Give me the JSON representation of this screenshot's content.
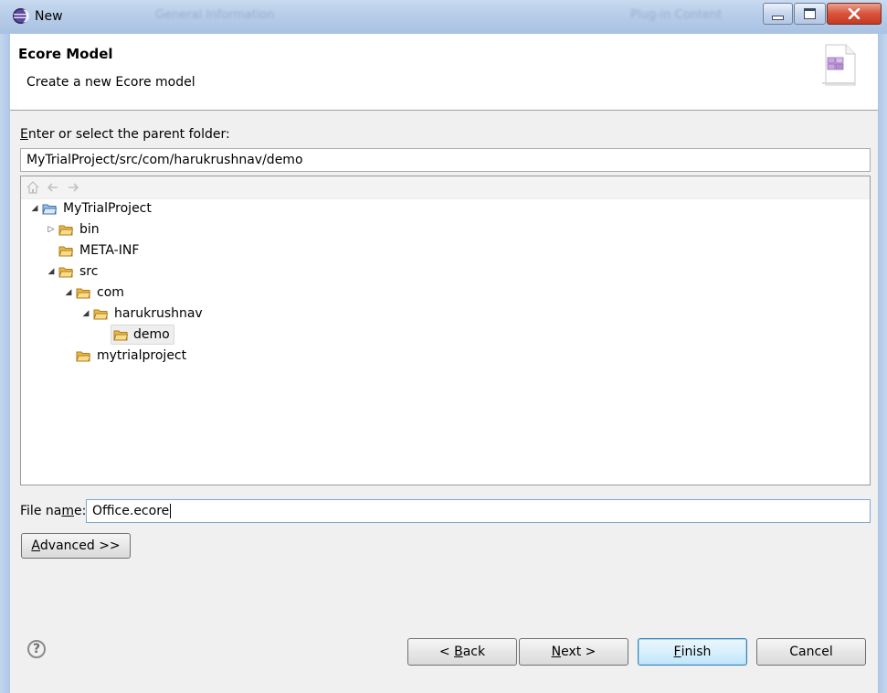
{
  "window": {
    "title": "New",
    "background_tab_hint_1": "General Information",
    "background_tab_hint_2": "Plug-in Content"
  },
  "banner": {
    "title": "Ecore Model",
    "description": "Create a new Ecore model",
    "image_icon": "ecore-wizard-icon"
  },
  "parent_folder": {
    "label_mnemonic": "E",
    "label_rest": "nter or select the parent folder:",
    "value": "MyTrialProject/src/com/harukrushnav/demo"
  },
  "tree_toolbar": {
    "icons": [
      "home-icon",
      "back-icon",
      "forward-icon"
    ]
  },
  "tree": {
    "nodes": [
      {
        "label": "MyTrialProject",
        "expanded": true,
        "icon": "project-folder-icon"
      },
      {
        "label": "bin",
        "expanded": false,
        "icon": "folder-icon"
      },
      {
        "label": "META-INF",
        "icon": "folder-icon"
      },
      {
        "label": "src",
        "expanded": true,
        "icon": "folder-icon"
      },
      {
        "label": "com",
        "expanded": true,
        "icon": "folder-icon"
      },
      {
        "label": "harukrushnav",
        "expanded": true,
        "icon": "folder-icon"
      },
      {
        "label": "demo",
        "selected": true,
        "icon": "folder-icon"
      },
      {
        "label": "mytrialproject",
        "icon": "folder-icon"
      }
    ]
  },
  "file_name": {
    "label_pre": "File na",
    "label_mnemonic": "m",
    "label_post": "e:",
    "value": "Office.ecore"
  },
  "advanced_button": {
    "mnemonic": "A",
    "rest": "dvanced >>"
  },
  "buttons": {
    "back": {
      "pre": "< ",
      "mnemonic": "B",
      "rest": "ack"
    },
    "next": {
      "mnemonic": "N",
      "rest": "ext >"
    },
    "finish": {
      "mnemonic": "F",
      "rest": "inish"
    },
    "cancel": "Cancel"
  },
  "colors": {
    "folder_yellow": "#e8b94a",
    "selection_bg": "#eeeeee",
    "default_button_border": "#3c7fb1"
  }
}
